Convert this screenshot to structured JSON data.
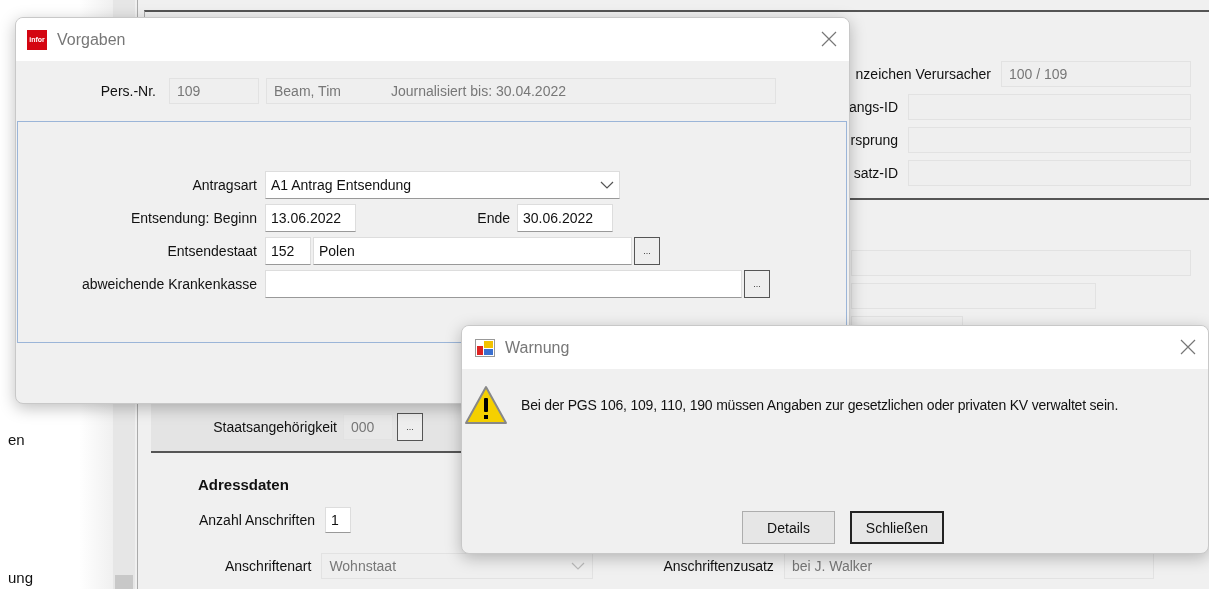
{
  "sidebar": {
    "items": [
      "en",
      "ung"
    ]
  },
  "main_form": {
    "top_fields": [
      {
        "label": "nzeichen Verursacher",
        "value": "100 / 109"
      },
      {
        "label": "angs-ID"
      },
      {
        "label": "rsprung"
      },
      {
        "label": "satz-ID"
      }
    ],
    "nationality": {
      "label": "Staatsangehörigkeit",
      "value": "000",
      "button": "..."
    },
    "address": {
      "heading": "Adressdaten",
      "count_label": "Anzahl Anschriften",
      "count": "1",
      "type_label": "Anschriftenart",
      "type": "Wohnstaat",
      "addition_label": "Anschriftenzusatz",
      "addition": "bei J. Walker"
    }
  },
  "vorgaben": {
    "title": "Vorgaben",
    "logo": "infor",
    "pers_label": "Pers.-Nr.",
    "pers_nr": "109",
    "name": "Beam, Tim",
    "journal": "Journalisiert bis: 30.04.2022",
    "antragsart_label": "Antragsart",
    "antragsart": "A1 Antrag Entsendung",
    "begin_label": "Entsendung: Beginn",
    "begin": "13.06.2022",
    "end_label": "Ende",
    "end": "30.06.2022",
    "state_label": "Entsendestaat",
    "state_code": "152",
    "state_name": "Polen",
    "state_button": "...",
    "insurance_label": "abweichende Krankenkasse",
    "insurance_button": "..."
  },
  "warnung": {
    "title": "Warnung",
    "message": "Bei der PGS 106, 109, 110, 190 müssen Angaben zur gesetzlichen oder privaten KV verwaltet sein.",
    "buttons": [
      {
        "label": "Details",
        "default": false
      },
      {
        "label": "Schließen",
        "default": true
      }
    ]
  }
}
